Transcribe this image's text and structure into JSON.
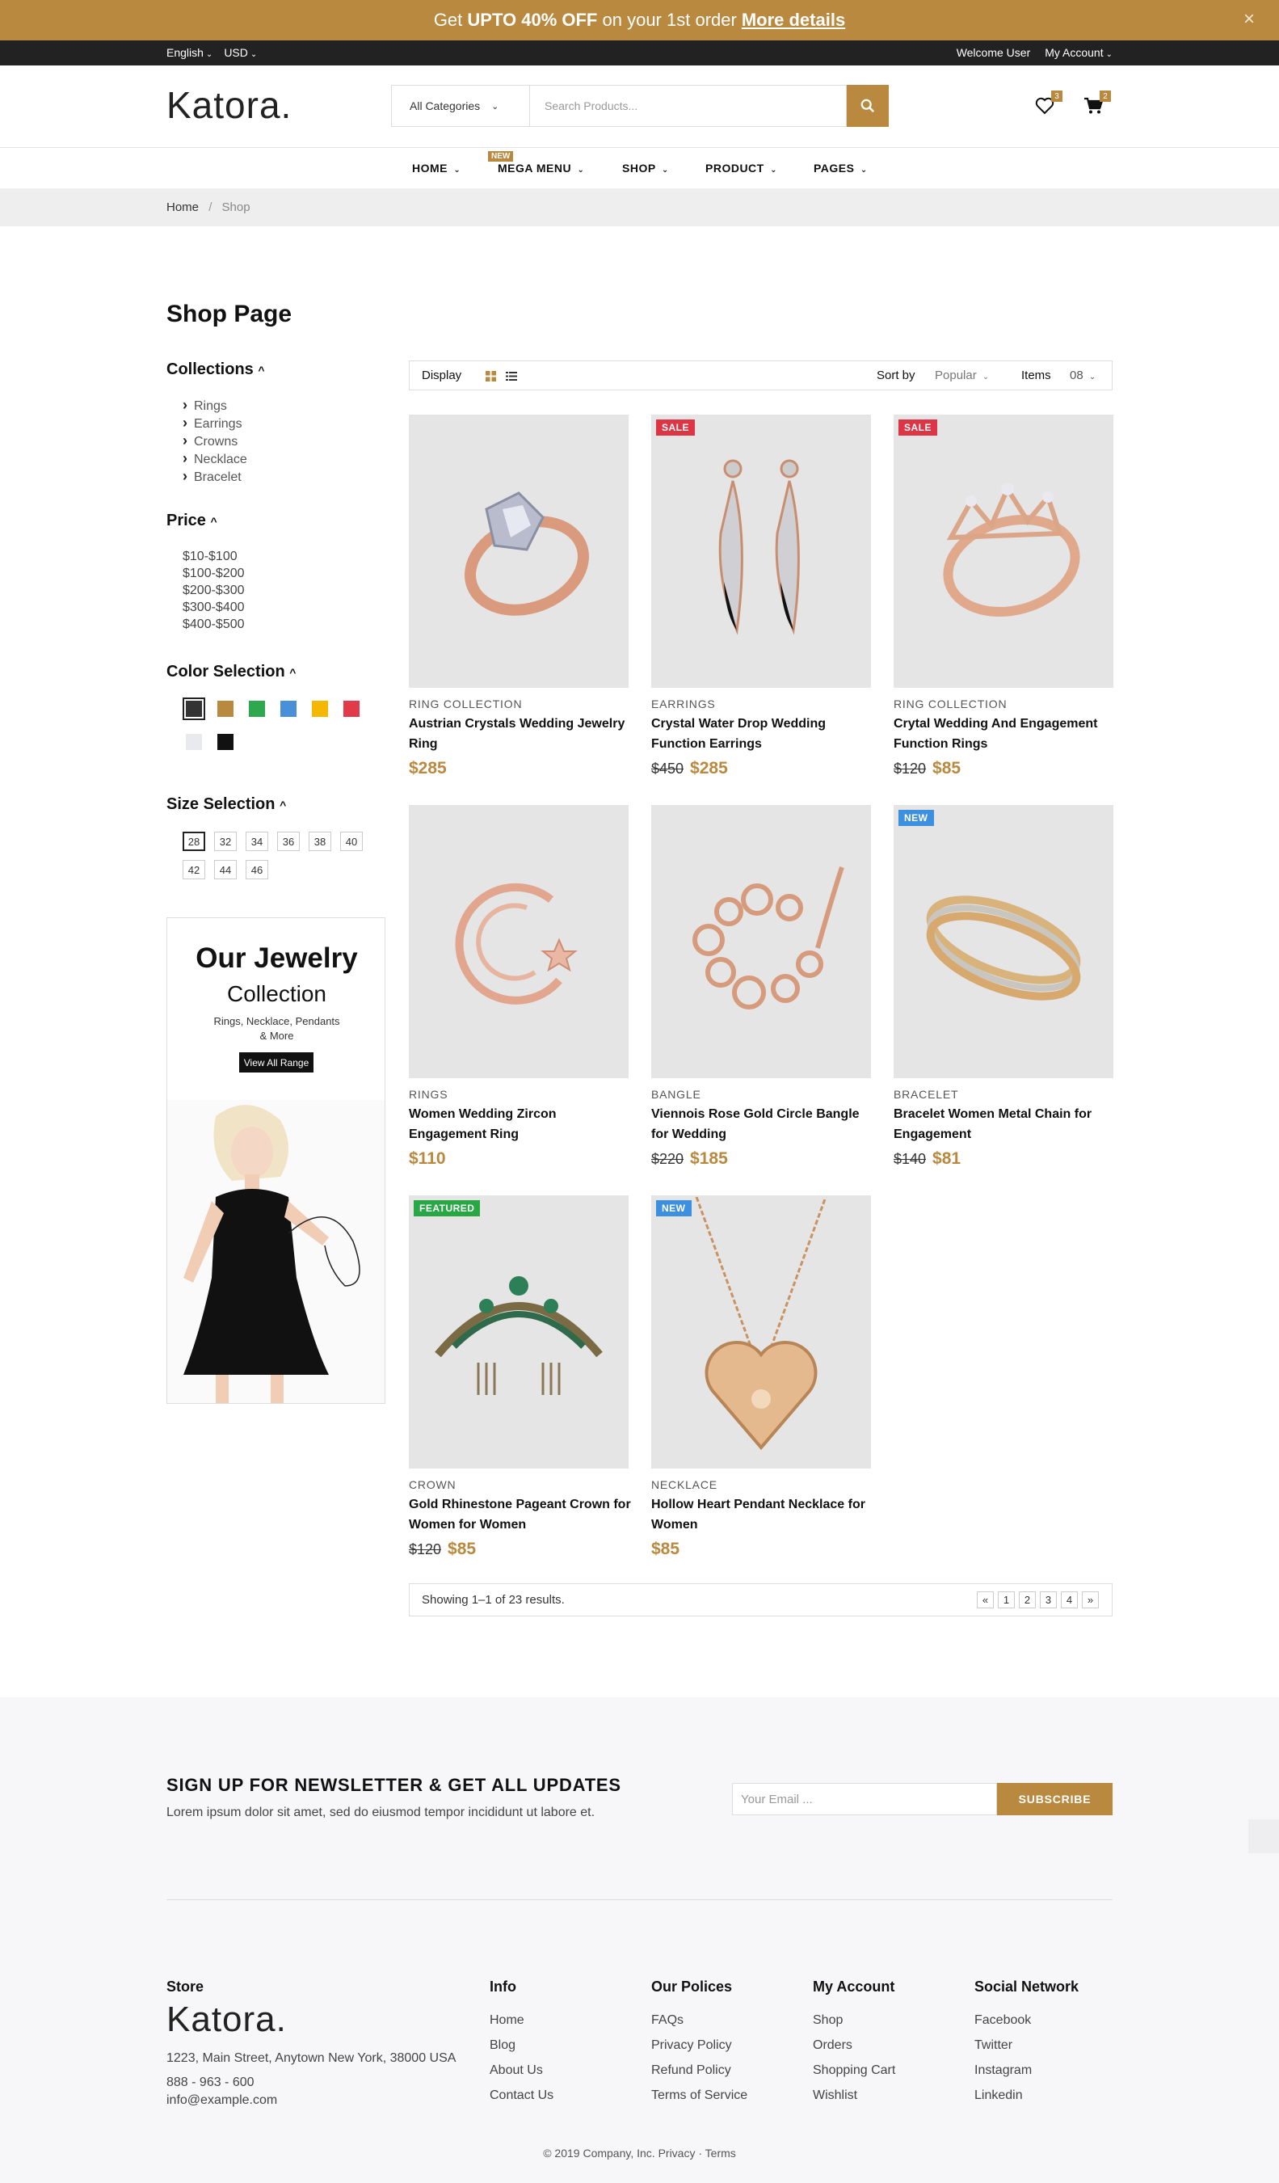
{
  "promo": {
    "prefix": "Get",
    "bold": "UPTO 40% OFF",
    "suffix": "on your 1st order",
    "link": "More details",
    "close": "×"
  },
  "topbar": {
    "language": "English",
    "currency": "USD",
    "welcome": "Welcome User",
    "account": "My Account"
  },
  "header": {
    "logo": "Katora",
    "category": "All Categories",
    "search_placeholder": "Search Products...",
    "wishlist_count": "3",
    "cart_count": "2"
  },
  "nav": {
    "items": [
      "HOME",
      "MEGA MENU",
      "SHOP",
      "PRODUCT",
      "PAGES"
    ],
    "new_tag": "NEW"
  },
  "breadcrumb": {
    "home": "Home",
    "sep": "/",
    "current": "Shop"
  },
  "sidebar": {
    "title": "Shop Page",
    "collections_label": "Collections",
    "collections": [
      "Rings",
      "Earrings",
      "Crowns",
      "Necklace",
      "Bracelet"
    ],
    "price_label": "Price",
    "prices": [
      "$10-$100",
      "$100-$200",
      "$200-$300",
      "$300-$400",
      "$400-$500"
    ],
    "color_label": "Color Selection",
    "colors": [
      "#333333",
      "#b8893e",
      "#2ea84f",
      "#4a90d9",
      "#f5b800",
      "#e03a4b",
      "#e8eaee",
      "#111111"
    ],
    "size_label": "Size Selection",
    "sizes": [
      "28",
      "32",
      "34",
      "36",
      "38",
      "40",
      "42",
      "44",
      "46"
    ],
    "banner": {
      "title": "Our Jewelry",
      "subtitle": "Collection",
      "text1": "Rings, Necklace, Pendants",
      "text2": "& More",
      "button": "View All Range"
    }
  },
  "toolbar": {
    "display_label": "Display",
    "sort_label": "Sort by",
    "sort_value": "Popular",
    "items_label": "Items",
    "items_value": "08"
  },
  "products": [
    {
      "category": "RING COLLECTION",
      "name": "Austrian Crystals Wedding Jewelry Ring",
      "old_price": "",
      "price": "$285",
      "badge": "",
      "icon": "ring-icon"
    },
    {
      "category": "EARRINGS",
      "name": "Crystal Water Drop Wedding Function Earrings",
      "old_price": "$450",
      "price": "$285",
      "badge": "SALE",
      "icon": "earrings-icon"
    },
    {
      "category": "RING COLLECTION",
      "name": "Crytal Wedding And Engagement Function Rings",
      "old_price": "$120",
      "price": "$85",
      "badge": "SALE",
      "icon": "crown-ring-icon"
    },
    {
      "category": "RINGS",
      "name": "Women Wedding Zircon Engagement Ring",
      "old_price": "",
      "price": "$110",
      "badge": "",
      "icon": "moon-ring-icon"
    },
    {
      "category": "BANGLE",
      "name": "Viennois Rose Gold Circle Bangle for Wedding",
      "old_price": "$220",
      "price": "$185",
      "badge": "",
      "icon": "bracelet-icon"
    },
    {
      "category": "BRACELET",
      "name": "Bracelet Women Metal Chain for Engagement",
      "old_price": "$140",
      "price": "$81",
      "badge": "NEW",
      "icon": "bangle-icon"
    },
    {
      "category": "CROWN",
      "name": "Gold Rhinestone Pageant Crown for Women for Women",
      "old_price": "$120",
      "price": "$85",
      "badge": "FEATURED",
      "icon": "tiara-icon"
    },
    {
      "category": "NECKLACE",
      "name": "Hollow Heart Pendant Necklace for Women",
      "old_price": "",
      "price": "$85",
      "badge": "NEW",
      "icon": "heart-pendant-icon"
    }
  ],
  "badge_colors": {
    "SALE": "#dc3545",
    "NEW": "#3d8fe0",
    "FEATURED": "#28a745"
  },
  "pagination": {
    "summary": "Showing 1–1 of 23 results.",
    "prev": "«",
    "pages": [
      "1",
      "2",
      "3",
      "4"
    ],
    "next": "»"
  },
  "newsletter": {
    "title": "SIGN UP FOR NEWSLETTER & GET ALL UPDATES",
    "text": "Lorem ipsum dolor sit amet, sed do eiusmod tempor incididunt ut labore et.",
    "placeholder": "Your Email ...",
    "button": "SUBSCRIBE"
  },
  "footer": {
    "store_label": "Store",
    "logo": "Katora",
    "address": "1223, Main Street, Anytown New York, 38000 USA",
    "phone": "888 - 963 - 600",
    "email": "info@example.com",
    "columns": [
      {
        "title": "Info",
        "links": [
          "Home",
          "Blog",
          "About Us",
          "Contact Us"
        ]
      },
      {
        "title": "Our Polices",
        "links": [
          "FAQs",
          "Privacy Policy",
          "Refund Policy",
          "Terms of Service"
        ]
      },
      {
        "title": "My Account",
        "links": [
          "Shop",
          "Orders",
          "Shopping Cart",
          "Wishlist"
        ]
      },
      {
        "title": "Social Network",
        "links": [
          "Facebook",
          "Twitter",
          "Instagram",
          "Linkedin"
        ]
      }
    ],
    "copyright": "© 2019 Company, Inc. Privacy · Terms"
  },
  "accent_color": "#b8893e"
}
